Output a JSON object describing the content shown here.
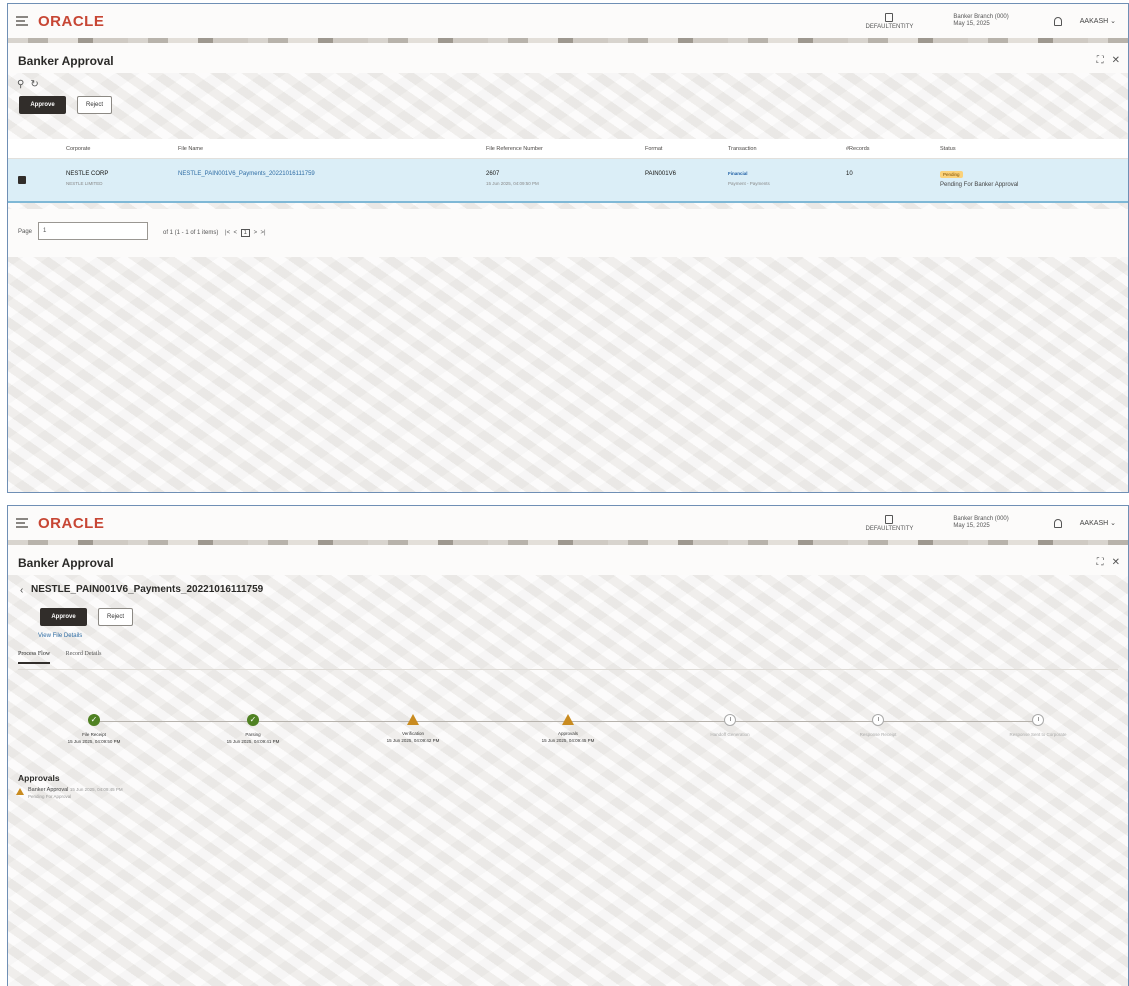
{
  "header": {
    "logo": "ORACLE",
    "entity": "DEFAULTENTITY",
    "branch_line1": "Banker Branch (000)",
    "branch_line2": "May 15, 2025",
    "user": "AAKASH"
  },
  "page_title": "Banker Approval",
  "actions": {
    "approve": "Approve",
    "reject": "Reject"
  },
  "table": {
    "headers": [
      "Corporate",
      "File Name",
      "File Reference Number",
      "Format",
      "Transaction",
      "#Records",
      "Status"
    ],
    "row": {
      "corporate": "NESTLE CORP",
      "corporate_sub": "NESTLE LIMITED",
      "file_name": "NESTLE_PAIN001V6_Payments_20221016111759",
      "file_ref": "2607",
      "file_ref_sub": "15 Jun 2025, 04:09:50 PM",
      "format": "PAIN001V6",
      "transaction_badge": "Financial",
      "transaction_sub": "Payment - Payments",
      "records": "10",
      "status_badge": "Pending",
      "status": "Pending For Banker Approval"
    }
  },
  "pager": {
    "label": "Page",
    "value": "1",
    "info": "of 1  (1 - 1 of 1 items)",
    "nav_first": "|<",
    "nav_prev": "<",
    "current": "1",
    "nav_next": ">",
    "nav_last": ">|"
  },
  "detail": {
    "file_title": "NESTLE_PAIN001V6_Payments_20221016111759",
    "view_file_details": "View File Details",
    "tabs": [
      "Process Flow",
      "Record Details"
    ],
    "steps": [
      {
        "name": "File Receipt",
        "ts": "15 Jun 2025, 04:09:50 PM",
        "state": "done"
      },
      {
        "name": "Parsing",
        "ts": "15 Jun 2025, 04:09:41 PM",
        "state": "done"
      },
      {
        "name": "Verification",
        "ts": "15 Jun 2025, 04:09:42 PM",
        "state": "warn"
      },
      {
        "name": "Approvals",
        "ts": "15 Jun 2025, 04:09:45 PM",
        "state": "warn"
      },
      {
        "name": "Handoff Generation",
        "ts": "",
        "state": "pending"
      },
      {
        "name": "Response Receipt",
        "ts": "",
        "state": "pending"
      },
      {
        "name": "Response Sent to Corporate",
        "ts": "",
        "state": "pending"
      }
    ],
    "approvals_heading": "Approvals",
    "approval": {
      "name": "Banker Approval",
      "ts": "15 Jun 2025, 04:09:45 PM",
      "status": "Pending For Approval"
    }
  }
}
